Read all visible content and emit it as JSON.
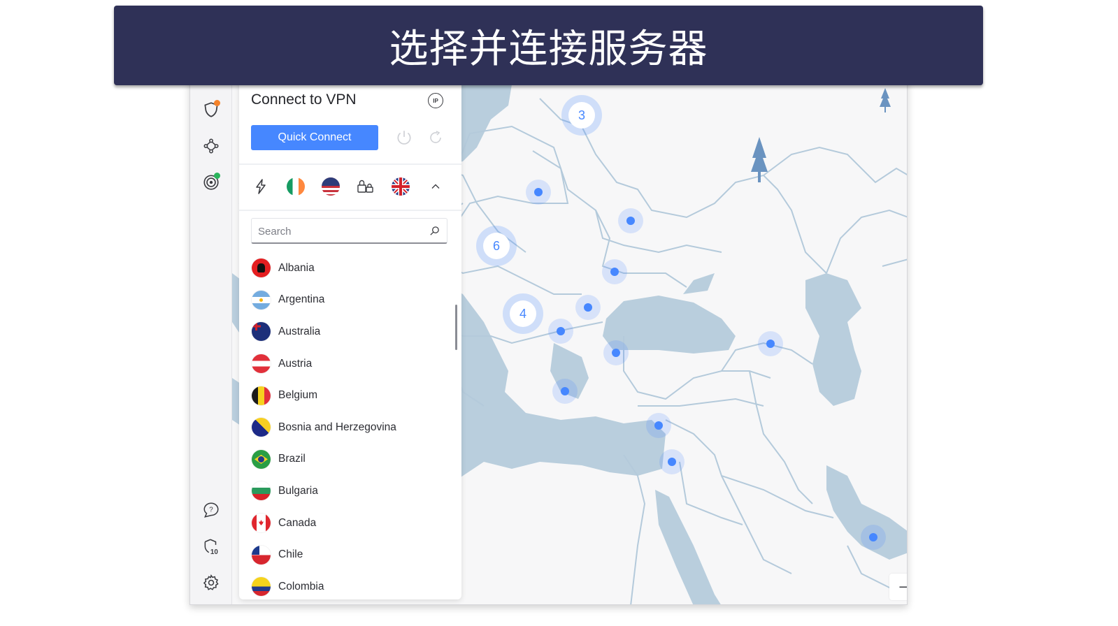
{
  "banner": {
    "title": "选择并连接服务器"
  },
  "sidebar": {
    "top_items": [
      {
        "icon": "shield-icon",
        "badge_color": "#f5832a"
      },
      {
        "icon": "meshnet-icon"
      },
      {
        "icon": "target-icon",
        "badge_color": "#2bb45c"
      }
    ],
    "bottom_items": [
      {
        "icon": "help-chat-icon"
      },
      {
        "icon": "shield-count-icon",
        "count": "10"
      },
      {
        "icon": "gear-icon"
      }
    ]
  },
  "panel": {
    "title": "Connect to VPN",
    "ip_label": "IP",
    "quick_connect_label": "Quick Connect",
    "shortcuts": [
      "lightning-icon",
      "ireland-flag",
      "united-states-flag",
      "dedicated-ip-icon",
      "united-kingdom-flag",
      "chevron-up-icon"
    ],
    "search_placeholder": "Search",
    "search_value": "",
    "countries": [
      {
        "name": "Albania",
        "flag": "albania"
      },
      {
        "name": "Argentina",
        "flag": "argentina"
      },
      {
        "name": "Australia",
        "flag": "australia"
      },
      {
        "name": "Austria",
        "flag": "austria"
      },
      {
        "name": "Belgium",
        "flag": "belgium"
      },
      {
        "name": "Bosnia and Herzegovina",
        "flag": "bosnia"
      },
      {
        "name": "Brazil",
        "flag": "brazil"
      },
      {
        "name": "Bulgaria",
        "flag": "bulgaria"
      },
      {
        "name": "Canada",
        "flag": "canada"
      },
      {
        "name": "Chile",
        "flag": "chile"
      },
      {
        "name": "Colombia",
        "flag": "colombia"
      }
    ]
  },
  "map": {
    "clusters": [
      {
        "label": "3",
        "region": "baltics"
      },
      {
        "label": "6",
        "region": "central-europe"
      },
      {
        "label": "4",
        "region": "balkans"
      }
    ],
    "server_markers": [
      "poland",
      "ukraine",
      "moldova",
      "romania",
      "serbia",
      "turkey",
      "greece",
      "georgia",
      "cyprus",
      "israel",
      "uae"
    ],
    "zoom_out_label": "−",
    "zoom_in_label": "+"
  },
  "colors": {
    "accent": "#4687ff",
    "banner_bg": "#2f3157",
    "water": "#b9cedd",
    "border_lines": "#b4cadb",
    "land": "#f7f7f8"
  }
}
